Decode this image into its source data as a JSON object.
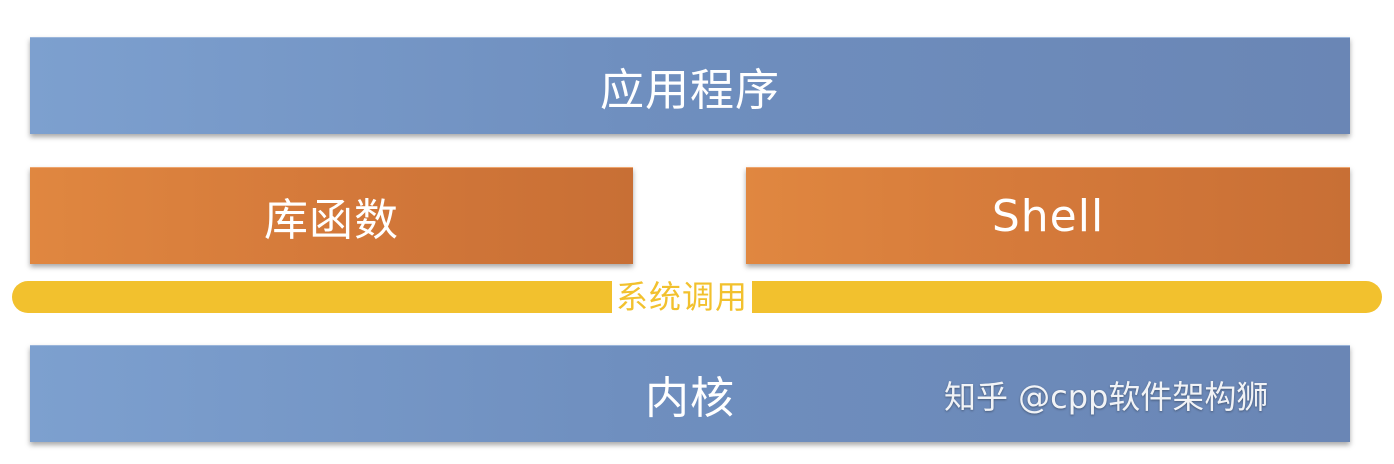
{
  "layers": {
    "application": "应用程序",
    "library": "库函数",
    "shell": "Shell",
    "syscall": "系统调用",
    "kernel": "内核"
  },
  "watermark": {
    "text": "知乎 @cpp软件架构狮"
  },
  "colors": {
    "blue_layer": "#6f8fbf",
    "orange_layer": "#d4793a",
    "syscall_bar": "#f2c12e",
    "label_text": "#ffffff"
  }
}
